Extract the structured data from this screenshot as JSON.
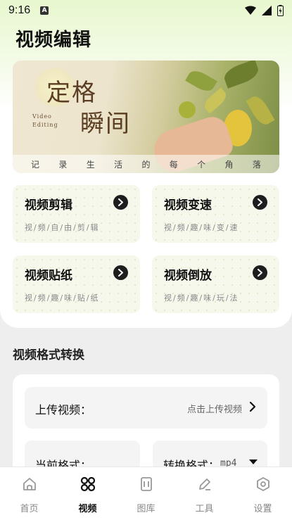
{
  "status_bar": {
    "time": "9:16",
    "notification_badge": "A"
  },
  "page": {
    "title": "视频编辑"
  },
  "banner": {
    "title_line1": "定格",
    "title_line2": "瞬间",
    "subtitle_en_line1": "Video",
    "subtitle_en_line2": "Editing",
    "caption_chars": [
      "记",
      "录",
      "生",
      "活",
      "的",
      "每",
      "个",
      "角",
      "落"
    ]
  },
  "features": [
    {
      "title": "视频剪辑",
      "subtitle": "视/频/自/由/剪/辑"
    },
    {
      "title": "视频变速",
      "subtitle": "视/频/趣/味/变/速"
    },
    {
      "title": "视频贴纸",
      "subtitle": "视/频/趣/味/贴/纸"
    },
    {
      "title": "视频倒放",
      "subtitle": "视/频/趣/味/玩/法"
    }
  ],
  "format_convert": {
    "section_title": "视频格式转换",
    "upload_label": "上传视频：",
    "upload_value": "点击上传视频",
    "current_label": "当前格式：",
    "target_label": "转换格式：",
    "target_value": "mp4"
  },
  "tab_bar": {
    "items": [
      {
        "label": "首页",
        "icon": "home-icon"
      },
      {
        "label": "视频",
        "icon": "video-grid-icon"
      },
      {
        "label": "图库",
        "icon": "gallery-icon"
      },
      {
        "label": "工具",
        "icon": "tools-icon"
      },
      {
        "label": "设置",
        "icon": "settings-icon"
      }
    ],
    "active_index": 1
  },
  "colors": {
    "accent_dark": "#1e1e1e",
    "header_gradient_start": "#e8f7cf",
    "card_bg": "#f6f8ec"
  }
}
